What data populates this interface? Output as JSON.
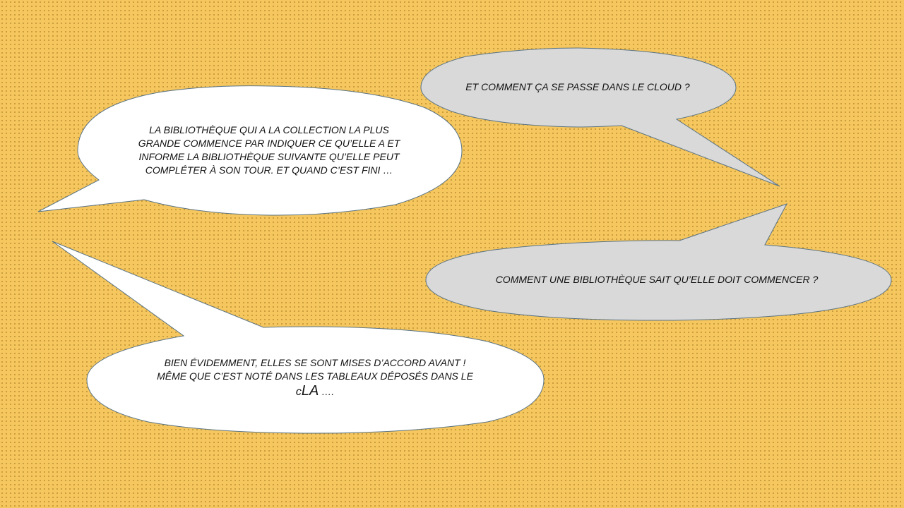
{
  "colors": {
    "background": "#f6c75f",
    "bubble_white": "#ffffff",
    "bubble_grey": "#d9d9d9",
    "bubble_stroke": "#5a7384"
  },
  "bubbles": {
    "top_left": {
      "lines": [
        "LA BIBLIOTHÈQUE QUI A LA COLLECTION LA PLUS",
        "GRANDE COMMENCE PAR INDIQUER CE QU’ELLE A ET",
        "INFORME LA BIBLIOTHÈQUE SUIVANTE QU’ELLE PEUT",
        "COMPLÉTER À SON TOUR. ET QUAND C’EST FINI …"
      ]
    },
    "top_right": {
      "text": "ET COMMENT ÇA SE PASSE DANS LE CLOUD ?"
    },
    "middle_right": {
      "text": "COMMENT UNE BIBLIOTHÈQUE SAIT QU’ELLE DOIT COMMENCER ?"
    },
    "bottom_left": {
      "lines": [
        "BIEN ÉVIDEMMENT, ELLES SE SONT MISES D’ACCORD AVANT !",
        "MÊME QUE C’EST NOTÉ DANS LES TABLEAUX DÉPOSÉS DANS LE"
      ],
      "last_line_small": "c",
      "last_line_big": "LA",
      "last_line_tail": " …."
    }
  }
}
